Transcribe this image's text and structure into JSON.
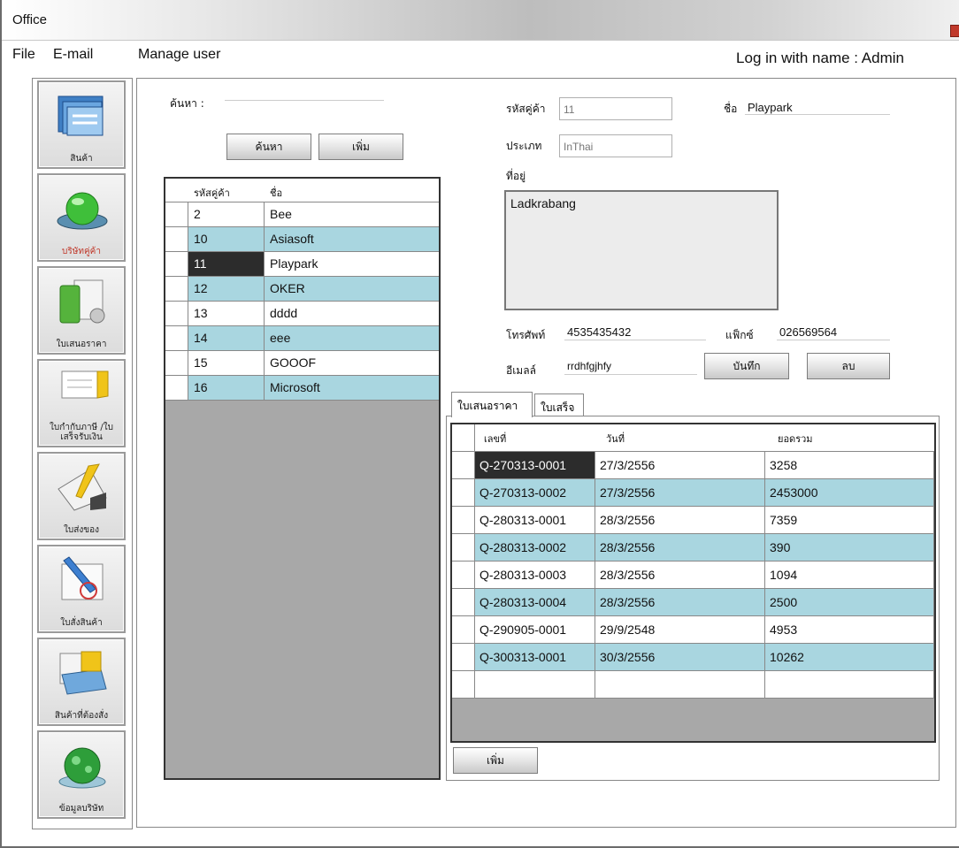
{
  "window": {
    "title": "Office"
  },
  "menu": {
    "items": [
      "File",
      "E-mail",
      "Manage user"
    ],
    "login_text": "Log in with name : Admin"
  },
  "sidebar": {
    "items": [
      {
        "label": "สินค้า",
        "icon": "folder-stack-icon"
      },
      {
        "label": "บริษัทคู่ค้า",
        "icon": "green-orb-icon"
      },
      {
        "label": "ใบเสนอราคา",
        "icon": "document-binder-icon"
      },
      {
        "label": "ใบกำกับภาษี /ใบเสร็จรับเงิน",
        "icon": "receipt-icon"
      },
      {
        "label": "ใบส่งของ",
        "icon": "delivery-note-icon"
      },
      {
        "label": "ใบสั่งสินค้า",
        "icon": "order-pen-icon"
      },
      {
        "label": "สินค้าที่ต้องสั่ง",
        "icon": "box-list-icon"
      },
      {
        "label": "ข้อมูลบริษัท",
        "icon": "company-globe-icon"
      }
    ]
  },
  "search": {
    "label": "ค้นหา :",
    "value": "",
    "search_button": "ค้นหา",
    "add_button": "เพิ่ม"
  },
  "customer_grid": {
    "columns": [
      "รหัสคู่ค้า",
      "ชื่อ"
    ],
    "rows": [
      {
        "id": "2",
        "name": "Bee"
      },
      {
        "id": "10",
        "name": "Asiasoft"
      },
      {
        "id": "11",
        "name": "Playpark"
      },
      {
        "id": "12",
        "name": "OKER"
      },
      {
        "id": "13",
        "name": "dddd"
      },
      {
        "id": "14",
        "name": "eee"
      },
      {
        "id": "15",
        "name": "GOOOF"
      },
      {
        "id": "16",
        "name": "Microsoft"
      }
    ],
    "selected_index": 2
  },
  "detail": {
    "code_label": "รหัสคู่ค้า",
    "code_value": "11",
    "name_label": "ชื่อ",
    "name_value": "Playpark",
    "type_label": "ประเภท",
    "type_value": "InThai",
    "address_label": "ที่อยู่",
    "address_value": "Ladkrabang",
    "phone_label": "โทรศัพท์",
    "phone_value": "4535435432",
    "fax_label": "แฟ็กซ์",
    "fax_value": "026569564",
    "email_label": "อีเมลล์",
    "email_value": "rrdhfgjhfy",
    "save_button": "บันทึก",
    "delete_button": "ลบ"
  },
  "tabs": {
    "items": [
      "ใบเสนอราคา",
      "ใบเสร็จ"
    ],
    "active": 0
  },
  "quote_grid": {
    "columns": [
      "เลขที่",
      "วันที่",
      "ยอดรวม"
    ],
    "rows": [
      {
        "no": "Q-270313-0001",
        "date": "27/3/2556",
        "total": "3258"
      },
      {
        "no": "Q-270313-0002",
        "date": "27/3/2556",
        "total": "2453000"
      },
      {
        "no": "Q-280313-0001",
        "date": "28/3/2556",
        "total": "7359"
      },
      {
        "no": "Q-280313-0002",
        "date": "28/3/2556",
        "total": "390"
      },
      {
        "no": "Q-280313-0003",
        "date": "28/3/2556",
        "total": "1094"
      },
      {
        "no": "Q-280313-0004",
        "date": "28/3/2556",
        "total": "2500"
      },
      {
        "no": "Q-290905-0001",
        "date": "29/9/2548",
        "total": "4953"
      },
      {
        "no": "Q-300313-0001",
        "date": "30/3/2556",
        "total": "10262"
      }
    ],
    "add_button": "เพิ่ม"
  },
  "colors": {
    "row_alt": "#a9d6e0",
    "row_plain": "#ffffff",
    "selection": "#2c2c2c",
    "grid_empty": "#a8a8a8"
  }
}
